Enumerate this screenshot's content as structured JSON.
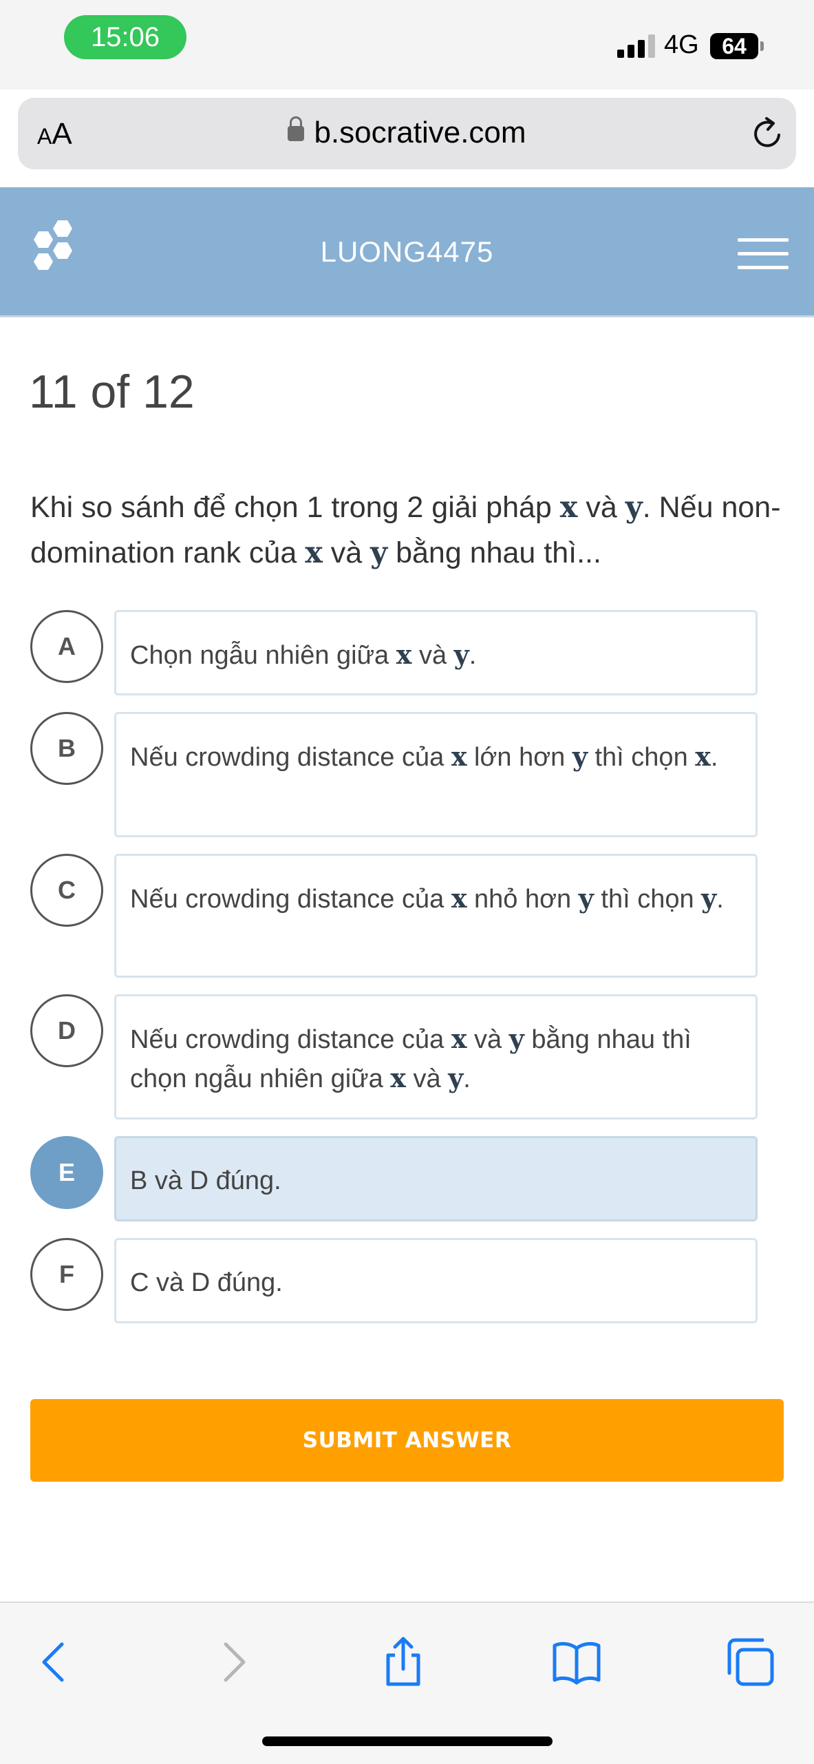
{
  "status_bar": {
    "time": "15:06",
    "network": "4G",
    "battery": "64"
  },
  "browser": {
    "text_size_label_small": "A",
    "text_size_label_large": "A",
    "url": "b.socrative.com"
  },
  "header": {
    "room_name": "LUONG4475"
  },
  "quiz": {
    "progress": "11 of 12",
    "question": [
      {
        "t": "Khi so sánh để chọn 1 trong 2 giải pháp "
      },
      {
        "m": "x"
      },
      {
        "t": " và "
      },
      {
        "m": "y"
      },
      {
        "t": ". Nếu non-domination rank của "
      },
      {
        "m": "x"
      },
      {
        "t": " và "
      },
      {
        "m": "y"
      },
      {
        "t": " bằng nhau thì..."
      }
    ],
    "answers": [
      {
        "letter": "A",
        "selected": false,
        "parts": [
          {
            "t": "Chọn ngẫu nhiên giữa "
          },
          {
            "m": "x"
          },
          {
            "t": " và "
          },
          {
            "m": "y"
          },
          {
            "t": "."
          }
        ]
      },
      {
        "letter": "B",
        "selected": false,
        "parts": [
          {
            "t": "Nếu crowding distance của "
          },
          {
            "m": "x"
          },
          {
            "t": " lớn hơn "
          },
          {
            "m": "y"
          },
          {
            "t": " thì chọn "
          },
          {
            "m": "x"
          },
          {
            "t": "."
          }
        ]
      },
      {
        "letter": "C",
        "selected": false,
        "parts": [
          {
            "t": "Nếu crowding distance của "
          },
          {
            "m": "x"
          },
          {
            "t": " nhỏ hơn "
          },
          {
            "m": "y"
          },
          {
            "t": " thì chọn "
          },
          {
            "m": "y"
          },
          {
            "t": "."
          }
        ]
      },
      {
        "letter": "D",
        "selected": false,
        "parts": [
          {
            "t": "Nếu crowding distance của "
          },
          {
            "m": "x"
          },
          {
            "t": " và "
          },
          {
            "m": "y"
          },
          {
            "t": " bằng nhau thì chọn ngẫu nhiên giữa "
          },
          {
            "m": "x"
          },
          {
            "t": " và "
          },
          {
            "m": "y"
          },
          {
            "t": "."
          }
        ]
      },
      {
        "letter": "E",
        "selected": true,
        "parts": [
          {
            "t": "B và D đúng."
          }
        ]
      },
      {
        "letter": "F",
        "selected": false,
        "parts": [
          {
            "t": "C và D đúng."
          }
        ]
      }
    ],
    "submit_label": "SUBMIT ANSWER"
  },
  "toolbar": {
    "icons": [
      "back-icon",
      "forward-icon",
      "share-icon",
      "bookmarks-icon",
      "tabs-icon"
    ]
  },
  "colors": {
    "header": "#89b1d4",
    "submit": "#ffa000",
    "selected": "#6f9fc7",
    "selected_bg": "#dce9f4",
    "time_pill": "#34c759"
  }
}
